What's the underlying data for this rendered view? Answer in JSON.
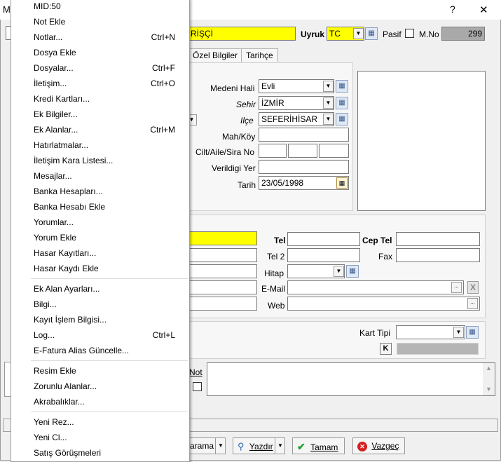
{
  "window": {
    "title_fragment": "M",
    "help_label": "?",
    "close_label": "✕"
  },
  "header": {
    "name_value": "RİŞÇİ",
    "uyruk_label": "Uyruk",
    "uyruk_value": "TC",
    "pasif_label": "Pasif",
    "mno_label": "M.No",
    "mno_value": "299"
  },
  "tabs": [
    "Özel Bilgiler",
    "Tarihçe"
  ],
  "identity": {
    "medeni_hali_label": "Medeni Hali",
    "medeni_hali_value": "Evli",
    "sehir_label": "Sehir",
    "sehir_value": "İZMİR",
    "ilce_label": "Ilçe",
    "ilce_value": "SEFERİHİSAR",
    "mah_koy_label": "Mah/Köy",
    "cilt_label": "Cilt/Aile/Sira No",
    "verildigi_yer_label": "Verildigi Yer",
    "tarih_label": "Tarih",
    "tarih_value": "23/05/1998"
  },
  "contact": {
    "tel_label": "Tel",
    "cep_tel_label": "Cep Tel",
    "tel2_label": "Tel 2",
    "fax_label": "Fax",
    "hitap_label": "Hitap",
    "email_label": "E-Mail",
    "web_label": "Web",
    "ellipsis": "...",
    "clear_label": "X"
  },
  "card": {
    "kart_tipi_label": "Kart Tipi",
    "k_label": "K"
  },
  "note": {
    "not_label": "Not"
  },
  "buttons": {
    "arama_label": "arama",
    "yazdir_label": "Yazdır",
    "tamam_label": "Tamam",
    "vazgec_label": "Vazgeç"
  },
  "context_menu": [
    {
      "label": "MID:50",
      "shortcut": ""
    },
    {
      "label": "Not Ekle",
      "shortcut": ""
    },
    {
      "label": "Notlar...",
      "shortcut": "Ctrl+N"
    },
    {
      "label": "Dosya Ekle",
      "shortcut": ""
    },
    {
      "label": "Dosyalar...",
      "shortcut": "Ctrl+F"
    },
    {
      "label": "İletişim...",
      "shortcut": "Ctrl+O"
    },
    {
      "label": "Kredi Kartları...",
      "shortcut": ""
    },
    {
      "label": "Ek Bilgiler...",
      "shortcut": ""
    },
    {
      "label": "Ek Alanlar...",
      "shortcut": "Ctrl+M"
    },
    {
      "label": "Hatırlatmalar...",
      "shortcut": ""
    },
    {
      "label": "İletişim Kara Listesi...",
      "shortcut": ""
    },
    {
      "label": "Mesajlar...",
      "shortcut": ""
    },
    {
      "label": "Banka Hesapları...",
      "shortcut": ""
    },
    {
      "label": "Banka Hesabı Ekle",
      "shortcut": ""
    },
    {
      "label": "Yorumlar...",
      "shortcut": ""
    },
    {
      "label": "Yorum Ekle",
      "shortcut": ""
    },
    {
      "label": "Hasar Kayıtları...",
      "shortcut": ""
    },
    {
      "label": "Hasar Kaydı Ekle",
      "shortcut": ""
    },
    {
      "label": "Ek Alan Ayarları...",
      "shortcut": ""
    },
    {
      "label": "Bilgi...",
      "shortcut": ""
    },
    {
      "label": "Kayıt İşlem Bilgisi...",
      "shortcut": ""
    },
    {
      "label": "Log...",
      "shortcut": "Ctrl+L"
    },
    {
      "label": "E-Fatura Alias Güncelle...",
      "shortcut": ""
    },
    {
      "label": "Resim Ekle",
      "shortcut": ""
    },
    {
      "label": "Zorunlu Alanlar...",
      "shortcut": ""
    },
    {
      "label": "Akrabalıklar...",
      "shortcut": ""
    },
    {
      "label": "Yeni Rez...",
      "shortcut": ""
    },
    {
      "label": "Yeni Cl...",
      "shortcut": ""
    },
    {
      "label": "Satış Görüşmeleri",
      "shortcut": ""
    }
  ]
}
